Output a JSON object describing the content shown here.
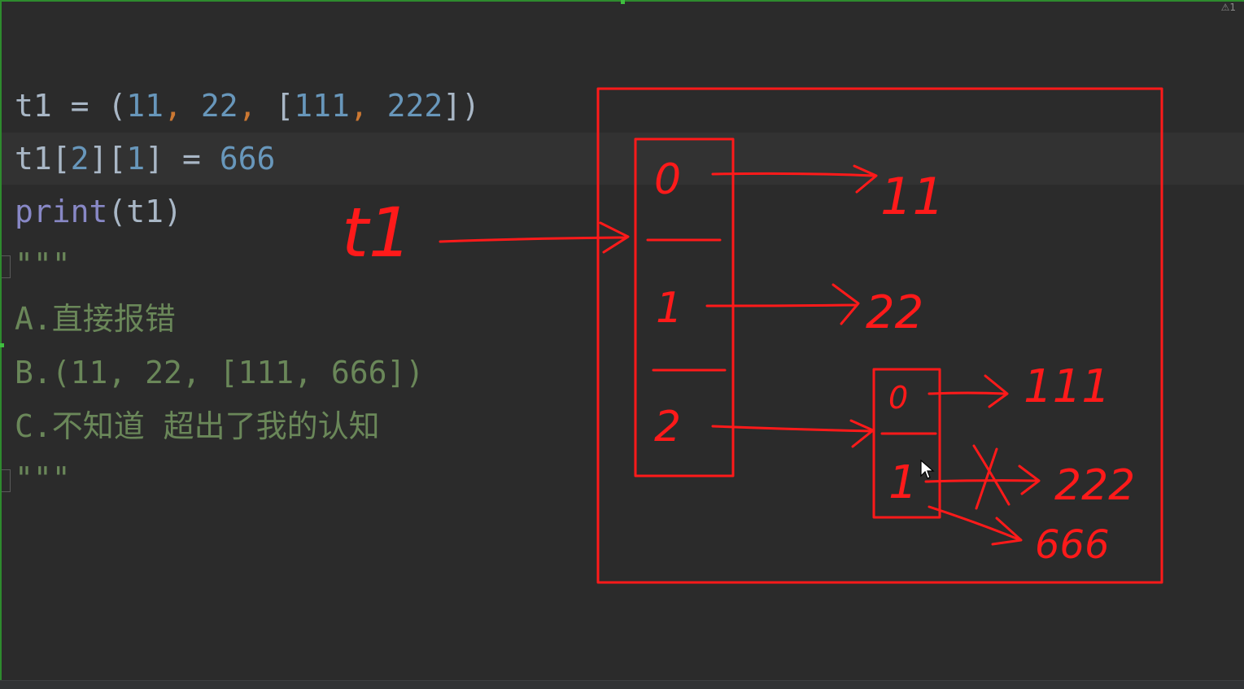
{
  "editor": {
    "inspection_badge": "⚠1",
    "lines": {
      "l1": {
        "t1": "t1",
        "eq": " = ",
        "lp": "(",
        "n11": "11",
        "c1": ", ",
        "n22": "22",
        "c2": ", ",
        "lb": "[",
        "n111": "111",
        "c3": ", ",
        "n222": "222",
        "rb": "])"
      },
      "l2": {
        "t1": "t1",
        "b1": "[",
        "i2": "2",
        "b2": "][",
        "i1": "1",
        "b3": "]",
        "eq": " = ",
        "n666": "666"
      },
      "l3": {
        "print": "print",
        "args": "(t1)"
      },
      "l4": {
        "text": "\"\"\""
      },
      "l5": {
        "text": "A.直接报错"
      },
      "l6": {
        "text": "B.(11, 22, [111, 666])"
      },
      "l7": {
        "text": "C.不知道 超出了我的认知"
      },
      "l8": {
        "text": "\"\"\""
      }
    }
  },
  "annotation": {
    "ink_color": "#ff1a1a",
    "handwritten_labels": {
      "var_name": "t1",
      "tuple_index_0": "0",
      "tuple_index_1": "1",
      "tuple_index_2": "2",
      "value_11": "11",
      "value_22": "22",
      "list_index_0": "0",
      "list_index_1": "1",
      "value_111": "111",
      "value_222": "222",
      "value_666": "666",
      "cross_mark": "X"
    }
  },
  "colors": {
    "background": "#2b2b2b",
    "current_line": "#323232",
    "number": "#6897bb",
    "comma": "#cc7832",
    "builtin": "#8888c6",
    "string": "#6a8759",
    "identifier": "#a9b7c6"
  },
  "icons": [
    "mouse-cursor-icon",
    "fold-marker-icon",
    "warning-icon"
  ]
}
